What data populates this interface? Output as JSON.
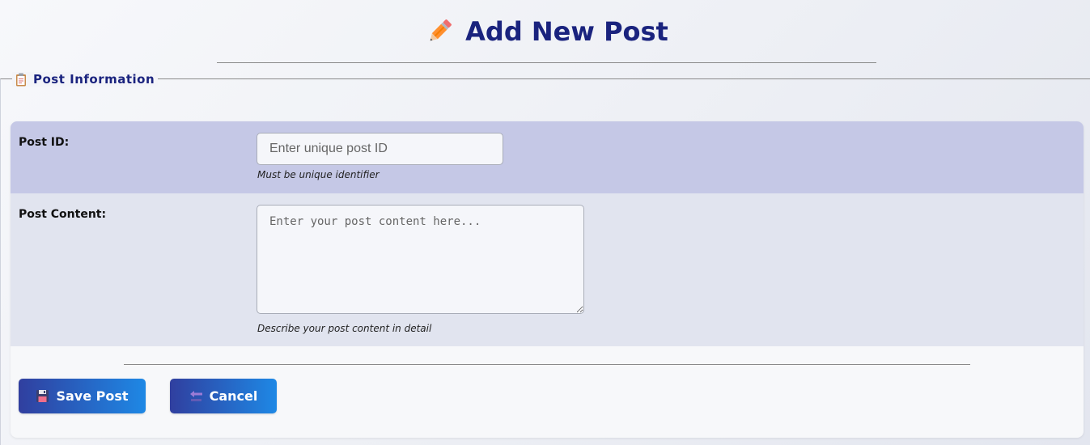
{
  "header": {
    "title": "Add New Post",
    "icon": "pencil-icon"
  },
  "section": {
    "legend": "Post Information",
    "icon": "clipboard-icon"
  },
  "form": {
    "post_id": {
      "label": "Post ID:",
      "placeholder": "Enter unique post ID",
      "value": "",
      "hint": "Must be unique identifier"
    },
    "post_content": {
      "label": "Post Content:",
      "placeholder": "Enter your post content here...",
      "value": "",
      "hint": "Describe your post content in detail"
    }
  },
  "actions": {
    "save_label": "Save Post",
    "save_icon": "floppy-disk-icon",
    "cancel_label": "Cancel",
    "cancel_icon": "back-arrow-icon"
  },
  "colors": {
    "title": "#1a237e",
    "row_highlight": "#c5c8e6",
    "row_alt": "#e1e4ef",
    "button_gradient_start": "#303f9f",
    "button_gradient_end": "#1e88e5"
  }
}
